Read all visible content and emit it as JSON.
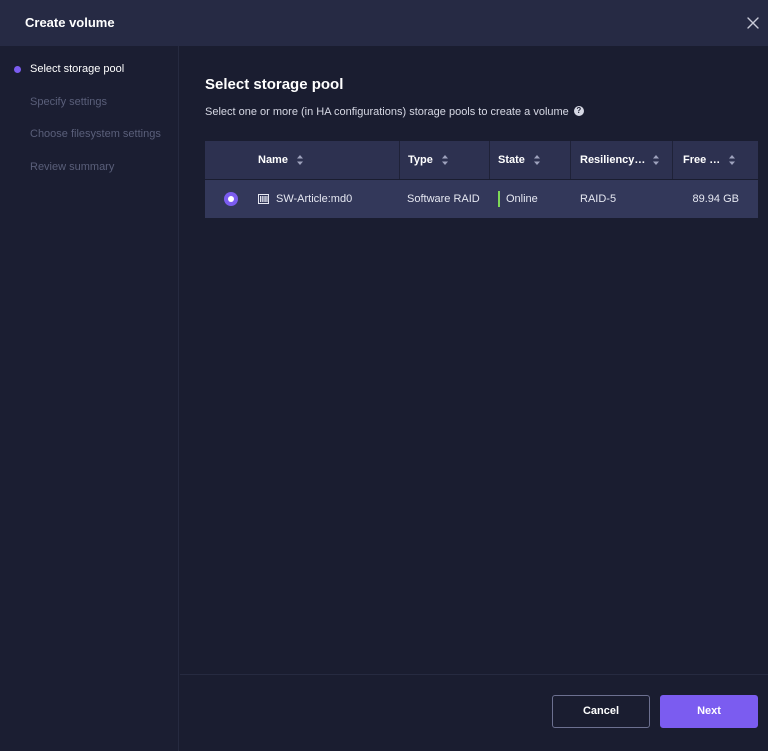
{
  "dialog": {
    "title": "Create volume",
    "close_icon": "close-icon"
  },
  "steps": [
    {
      "label": "Select storage pool",
      "active": true
    },
    {
      "label": "Specify settings",
      "active": false
    },
    {
      "label": "Choose filesystem settings",
      "active": false
    },
    {
      "label": "Review summary",
      "active": false
    }
  ],
  "main": {
    "heading": "Select storage pool",
    "description": "Select one or more (in HA configurations) storage pools to create a volume",
    "help_icon": "help-icon"
  },
  "table": {
    "columns": [
      "Name",
      "Type",
      "State",
      "Resiliency…",
      "Free …"
    ],
    "rows": [
      {
        "selected": true,
        "name": "SW-Article:md0",
        "type": "Software RAID",
        "state": "Online",
        "resiliency": "RAID-5",
        "free": "89.94 GB"
      }
    ]
  },
  "footer": {
    "cancel_label": "Cancel",
    "next_label": "Next"
  },
  "colors": {
    "accent": "#7b5cf0",
    "online": "#7ed957",
    "background": "#1a1d30",
    "titlebar": "#262a44"
  }
}
